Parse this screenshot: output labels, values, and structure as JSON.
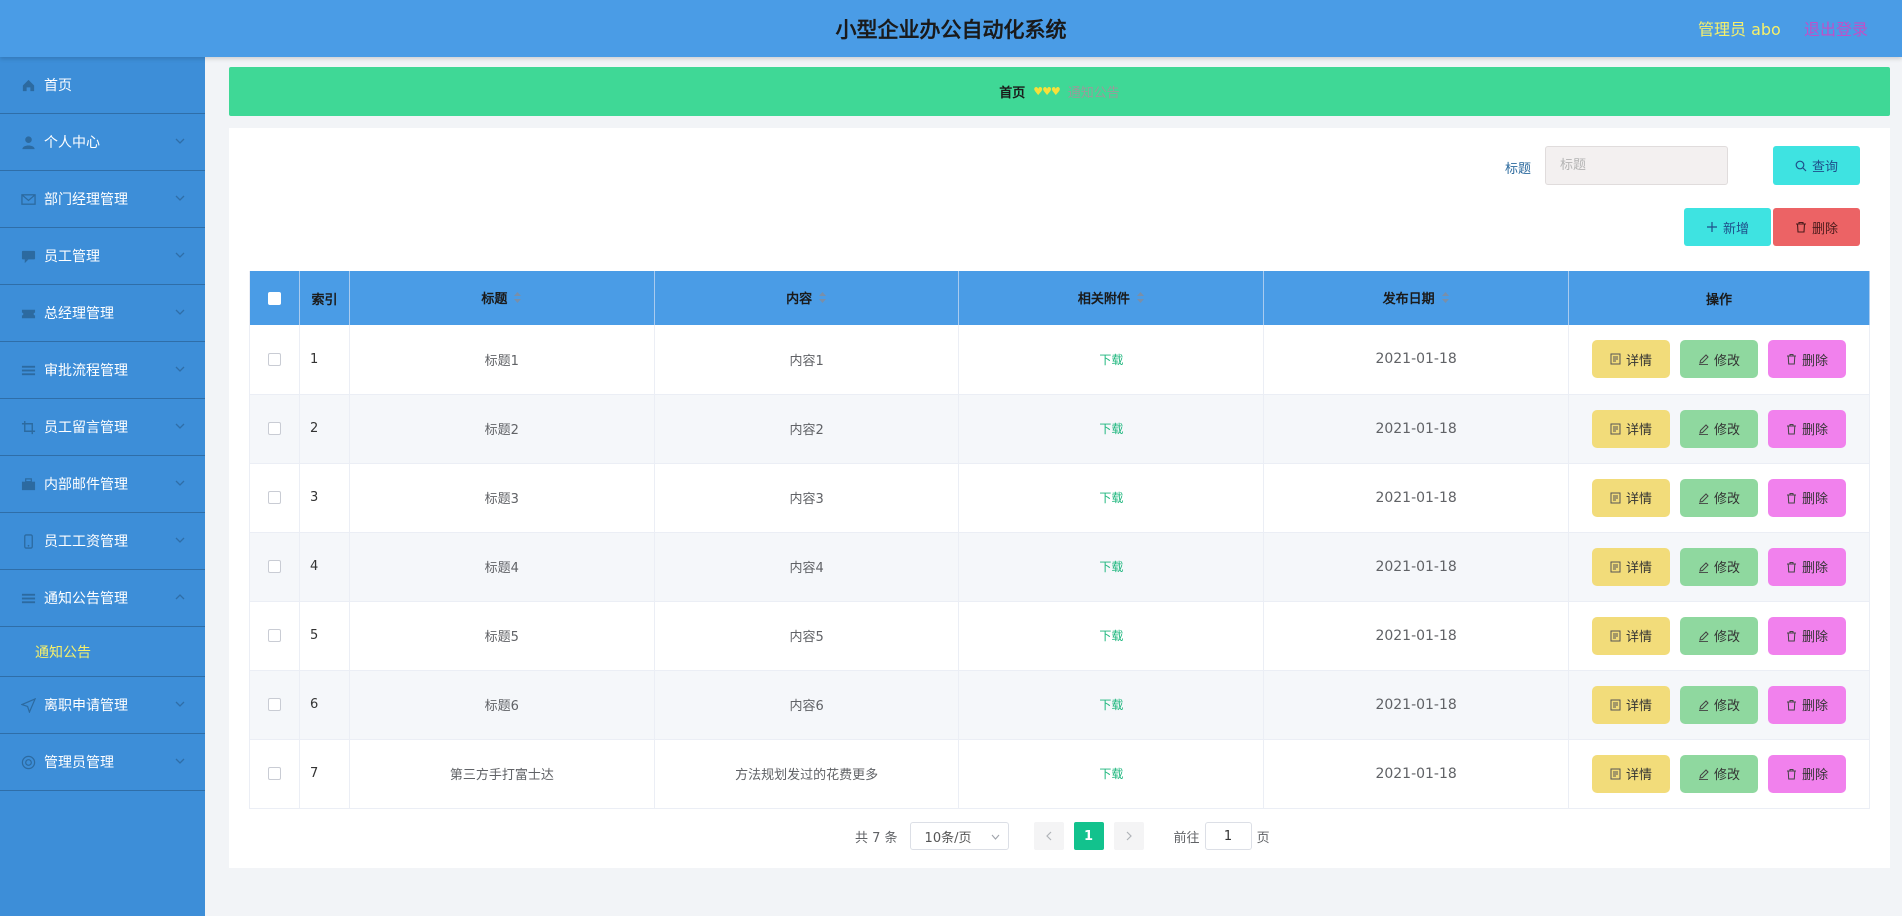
{
  "app": {
    "title": "小型企业办公自动化系统",
    "admin_label": "管理员 abo",
    "logout_label": "退出登录"
  },
  "sidebar": {
    "items": [
      {
        "label": "首页",
        "icon": "home-icon"
      },
      {
        "label": "个人中心",
        "icon": "user-icon"
      },
      {
        "label": "部门经理管理",
        "icon": "mail-icon"
      },
      {
        "label": "员工管理",
        "icon": "chat-icon"
      },
      {
        "label": "总经理管理",
        "icon": "ticket-icon"
      },
      {
        "label": "审批流程管理",
        "icon": "list-icon"
      },
      {
        "label": "员工留言管理",
        "icon": "crop-icon"
      },
      {
        "label": "内部邮件管理",
        "icon": "briefcase-icon"
      },
      {
        "label": "员工工资管理",
        "icon": "phone-icon"
      },
      {
        "label": "通知公告管理",
        "icon": "list-icon"
      },
      {
        "label": "离职申请管理",
        "icon": "send-icon"
      },
      {
        "label": "管理员管理",
        "icon": "globe-icon"
      }
    ],
    "sub_item": "通知公告"
  },
  "breadcrumb": {
    "home": "首页",
    "separator": "♥♥♥",
    "current": "通知公告"
  },
  "search": {
    "label": "标题",
    "placeholder": "标题",
    "query_label": "查询"
  },
  "actions": {
    "add_label": "新增",
    "delete_label": "删除"
  },
  "table": {
    "columns": [
      "索引",
      "标题",
      "内容",
      "相关附件",
      "发布日期",
      "操作"
    ],
    "rows": [
      {
        "index": "1",
        "title": "标题1",
        "content": "内容1",
        "attachment": "下载",
        "date": "2021-01-18"
      },
      {
        "index": "2",
        "title": "标题2",
        "content": "内容2",
        "attachment": "下载",
        "date": "2021-01-18"
      },
      {
        "index": "3",
        "title": "标题3",
        "content": "内容3",
        "attachment": "下载",
        "date": "2021-01-18"
      },
      {
        "index": "4",
        "title": "标题4",
        "content": "内容4",
        "attachment": "下载",
        "date": "2021-01-18"
      },
      {
        "index": "5",
        "title": "标题5",
        "content": "内容5",
        "attachment": "下载",
        "date": "2021-01-18"
      },
      {
        "index": "6",
        "title": "标题6",
        "content": "内容6",
        "attachment": "下载",
        "date": "2021-01-18"
      },
      {
        "index": "7",
        "title": "第三方手打富士达",
        "content": "方法规划发过的花费更多",
        "attachment": "下载",
        "date": "2021-01-18"
      }
    ],
    "row_actions": {
      "detail": "详情",
      "edit": "修改",
      "delete": "删除"
    }
  },
  "pagination": {
    "total": "共 7 条",
    "page_size": "10条/页",
    "current_page": "1",
    "goto_prefix": "前往",
    "goto_value": "1",
    "goto_suffix": "页"
  },
  "colors": {
    "header": "#4a9ce6",
    "sidebar": "#3d8ed8",
    "breadcrumb": "#3fd896",
    "accent_yellow": "#f7f06a",
    "detail_button": "#f2dc7a",
    "edit_button": "#8fd89f",
    "delete_button": "#f181ed",
    "pager_active": "#12c28d"
  }
}
